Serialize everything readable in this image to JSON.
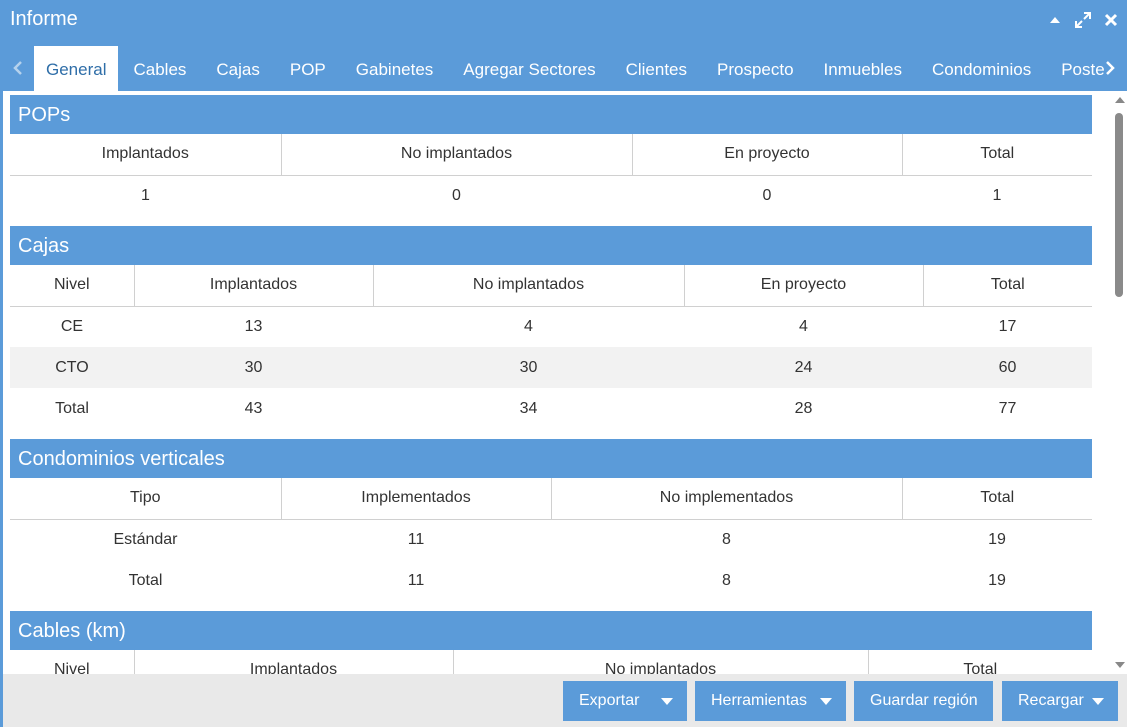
{
  "window": {
    "title": "Informe"
  },
  "tabs": [
    "General",
    "Cables",
    "Cajas",
    "POP",
    "Gabinetes",
    "Agregar Sectores",
    "Clientes",
    "Prospecto",
    "Inmuebles",
    "Condominios",
    "Poste"
  ],
  "pops": {
    "title": "POPs",
    "headers": [
      "Implantados",
      "No implantados",
      "En proyecto",
      "Total"
    ],
    "rows": [
      [
        "1",
        "0",
        "0",
        "1"
      ]
    ]
  },
  "cajas": {
    "title": "Cajas",
    "headers": [
      "Nivel",
      "Implantados",
      "No implantados",
      "En proyecto",
      "Total"
    ],
    "rows": [
      [
        "CE",
        "13",
        "4",
        "4",
        "17"
      ],
      [
        "CTO",
        "30",
        "30",
        "24",
        "60"
      ],
      [
        "Total",
        "43",
        "34",
        "28",
        "77"
      ]
    ]
  },
  "condominios": {
    "title": "Condominios verticales",
    "headers": [
      "Tipo",
      "Implementados",
      "No implementados",
      "Total"
    ],
    "rows": [
      [
        "Estándar",
        "11",
        "8",
        "19"
      ],
      [
        "Total",
        "11",
        "8",
        "19"
      ]
    ]
  },
  "cables": {
    "title": "Cables (km)",
    "headers": [
      "Nivel",
      "Implantados",
      "No implantados",
      "Total"
    ]
  },
  "footer": {
    "exportar": "Exportar",
    "herramientas": "Herramientas",
    "guardar": "Guardar región",
    "recargar": "Recargar"
  }
}
